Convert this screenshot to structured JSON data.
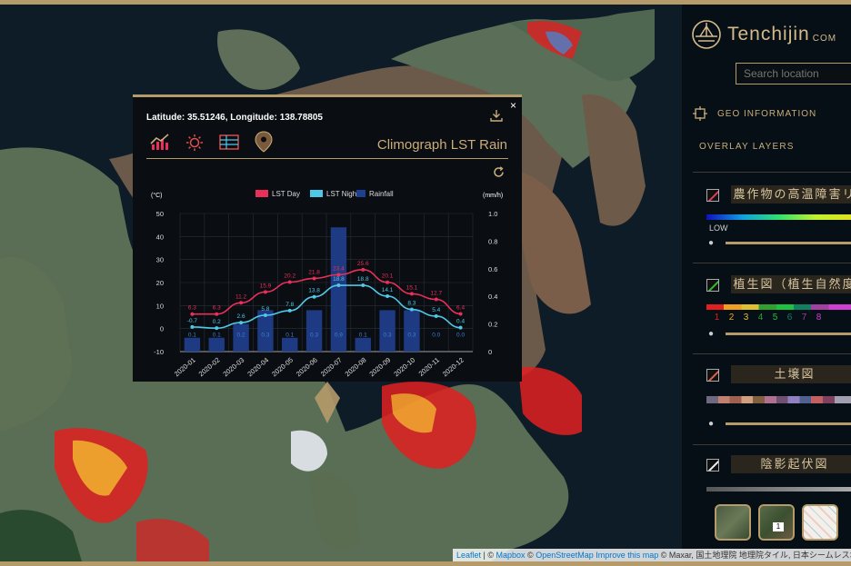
{
  "sidebar": {
    "brand": "Tenchijin",
    "brand_suffix": "COM",
    "search_placeholder": "Search location",
    "geo_info_label": "GEO INFORMATION",
    "overlay_layers_label": "OVERLAY LAYERS",
    "layers": [
      {
        "name": "農作物の高温障害リ",
        "check_color": "#e0405a",
        "low_label": "LOW"
      },
      {
        "name": "植生図（植生自然度",
        "check_color": "#2fbf2f",
        "legend_numbers": [
          "1",
          "2",
          "3",
          "4",
          "5",
          "6",
          "7",
          "8"
        ]
      },
      {
        "name": "土壌図",
        "check_color": "#e06050"
      },
      {
        "name": "陰影起伏図",
        "check_color": "#f0f0f0"
      }
    ],
    "thumbnail_badge": "1"
  },
  "attribution": {
    "leaflet": "Leaflet",
    "sep1": " | © ",
    "mapbox": "Mapbox",
    "sep2": " © ",
    "osm": "OpenStreetMap",
    "improve": "Improve this map",
    "rest": " © Maxar, 国土地理院 地理院タイル, 日本シームレス地質図"
  },
  "popup": {
    "close": "×",
    "coords": "Latitude: 35.51246, Longitude: 138.78805",
    "title": "Climograph LST Rain"
  },
  "chart_data": {
    "type": "line",
    "categories": [
      "2020-01",
      "2020-02",
      "2020-03",
      "2020-04",
      "2020-05",
      "2020-06",
      "2020-07",
      "2020-08",
      "2020-09",
      "2020-10",
      "2020-11",
      "2020-12"
    ],
    "ylabel_left": "(°C)",
    "ylabel_right": "(mm/h)",
    "ylim_left": [
      -10,
      50
    ],
    "ylim_right": [
      0,
      1.0
    ],
    "left_ticks": [
      "50",
      "40",
      "30",
      "20",
      "10",
      "0",
      "-10"
    ],
    "right_ticks": [
      "1.0",
      "0.8",
      "0.6",
      "0.4",
      "0.2",
      "0"
    ],
    "series": [
      {
        "name": "LST Day",
        "type": "line",
        "color": "#e8305a",
        "values": [
          6.3,
          6.3,
          11.2,
          15.9,
          20.2,
          21.8,
          23.4,
          25.6,
          20.1,
          15.1,
          12.7,
          6.4
        ],
        "labels": [
          "6.3",
          "6.3",
          "11.2",
          "15.9",
          "20.2",
          "21.8",
          "23.4",
          "25.6",
          "20.1",
          "15.1",
          "12.7",
          "6.4"
        ]
      },
      {
        "name": "LST Night",
        "type": "line",
        "color": "#4fc8e8",
        "values": [
          0.7,
          0.2,
          2.6,
          5.8,
          7.8,
          13.8,
          18.8,
          18.8,
          14.1,
          8.3,
          5.4,
          0.4
        ],
        "labels": [
          "-0.7",
          "0.2",
          "2.6",
          "5.8",
          "7.8",
          "13.8",
          "18.8",
          "18.8",
          "14.1",
          "8.3",
          "5.4",
          "0.4"
        ]
      },
      {
        "name": "Rainfall",
        "type": "bar",
        "color": "#1f3f8f",
        "values": [
          0.1,
          0.1,
          0.2,
          0.3,
          0.1,
          0.3,
          0.9,
          0.1,
          0.3,
          0.3,
          0.0,
          0.0
        ],
        "labels": [
          "0.1",
          "0.1",
          "0.2",
          "0.3",
          "0.1",
          "0.3",
          "0.9",
          "0.1",
          "0.3",
          "0.3",
          "0.0",
          "0.0"
        ]
      }
    ],
    "grid": true,
    "legend": "top-center"
  }
}
